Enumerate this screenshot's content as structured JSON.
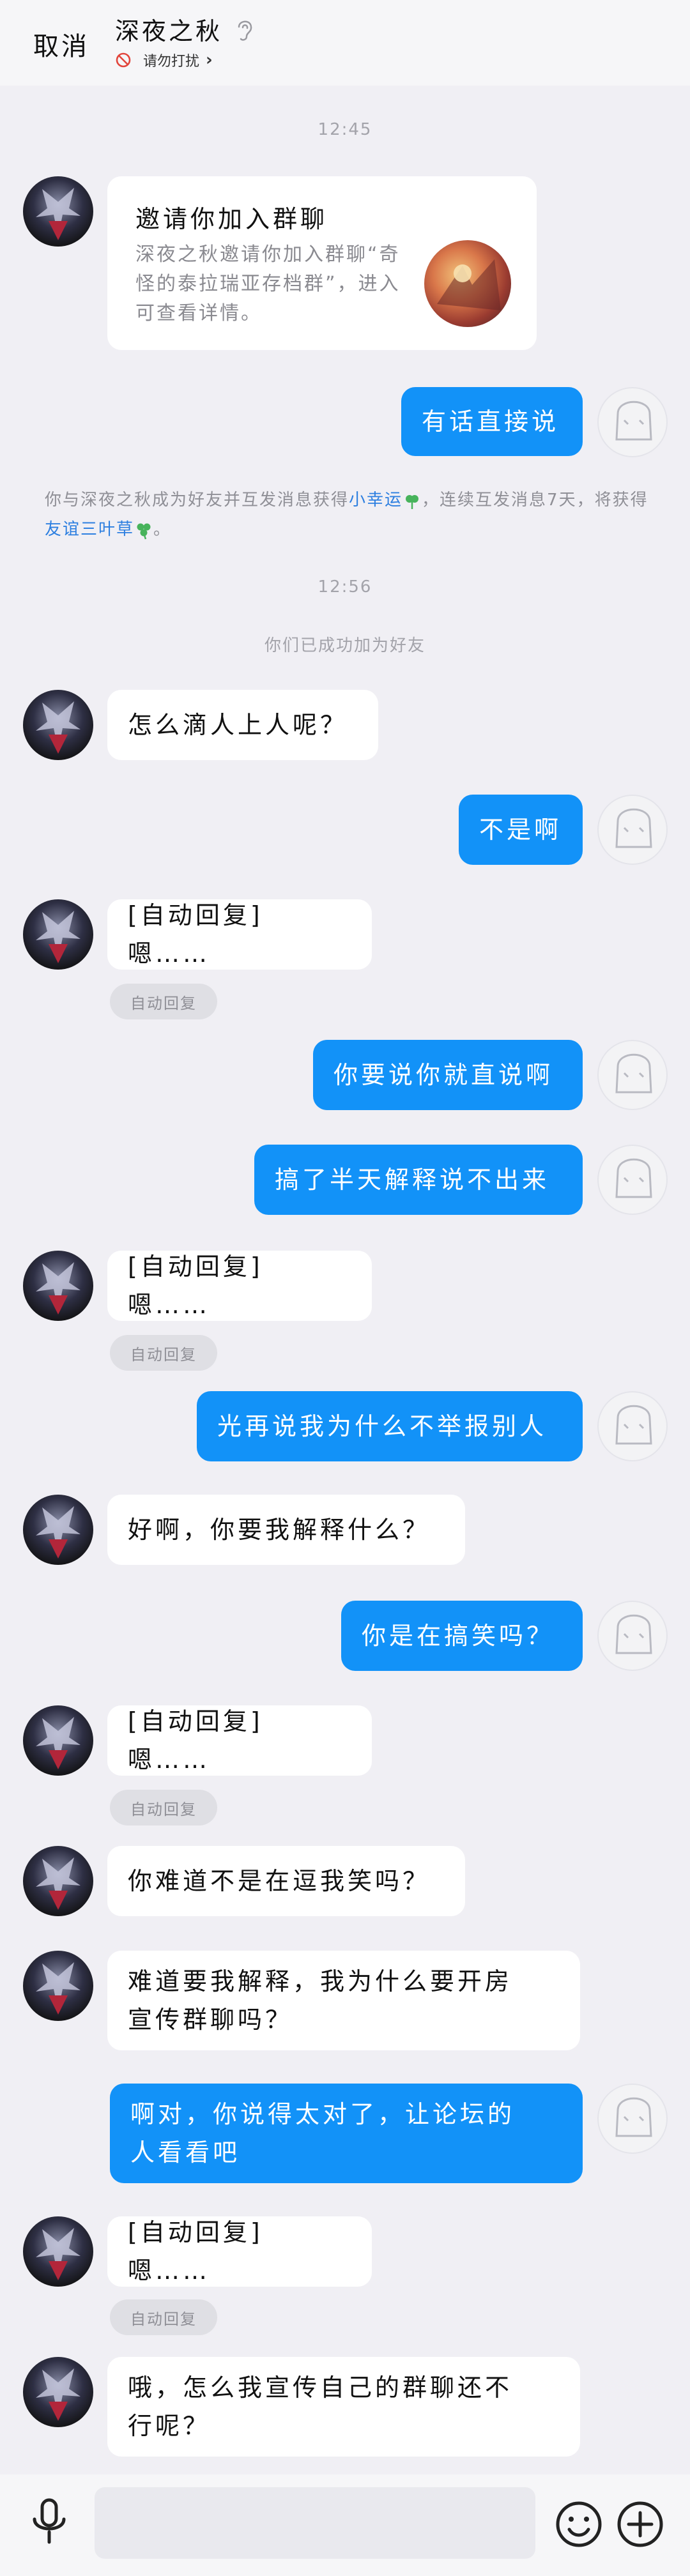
{
  "header": {
    "cancel_label": "取消",
    "contact_name": "深夜之秋",
    "dnd_label": "请勿打扰"
  },
  "messages": {
    "time1": "12:45",
    "invite_card": {
      "title": "邀请你加入群聊",
      "desc": "深夜之秋邀请你加入群聊“奇怪的泰拉瑞亚存档群”，进入可查看详情。"
    },
    "m1": "有话直接说",
    "sys_note": {
      "p1": "你与深夜之秋成为好友并互发消息获得",
      "link1": "小幸运",
      "p2": "，连续互发消息7天，将获得",
      "link2": "友谊三叶草",
      "p3": "。"
    },
    "time2": "12:56",
    "friend_note": "你们已成功加为好友",
    "m2": "怎么滴人上人呢？",
    "m3": "不是啊",
    "m4": "[自动回复] 嗯……",
    "m5": "你要说你就直说啊",
    "m6": "搞了半天解释说不出来",
    "m7": "[自动回复] 嗯……",
    "m8": "光再说我为什么不举报别人",
    "m9": "好啊，你要我解释什么？",
    "m10": "你是在搞笑吗？",
    "m11": "[自动回复] 嗯……",
    "m12": "你难道不是在逗我笑吗？",
    "m13_l1": "难道要我解释，我为什么要开房",
    "m13_l2": "宣传群聊吗？",
    "m14_l1": "啊对，你说得太对了，让论坛的",
    "m14_l2": "人看看吧",
    "m15": "[自动回复] 嗯……",
    "m16_l1": "哦，怎么我宣传自己的群聊还不",
    "m16_l2": "行呢？",
    "auto_tag": "自动回复"
  },
  "colors": {
    "accent": "#1292f8",
    "background": "#f0eff4",
    "link": "#2d7fe0"
  },
  "icons": {
    "ear": "ear-icon",
    "dnd": "no-disturb-icon",
    "mic": "microphone-icon",
    "emoji": "emoji-icon",
    "plus": "plus-icon",
    "leaf": "clover-icon"
  }
}
